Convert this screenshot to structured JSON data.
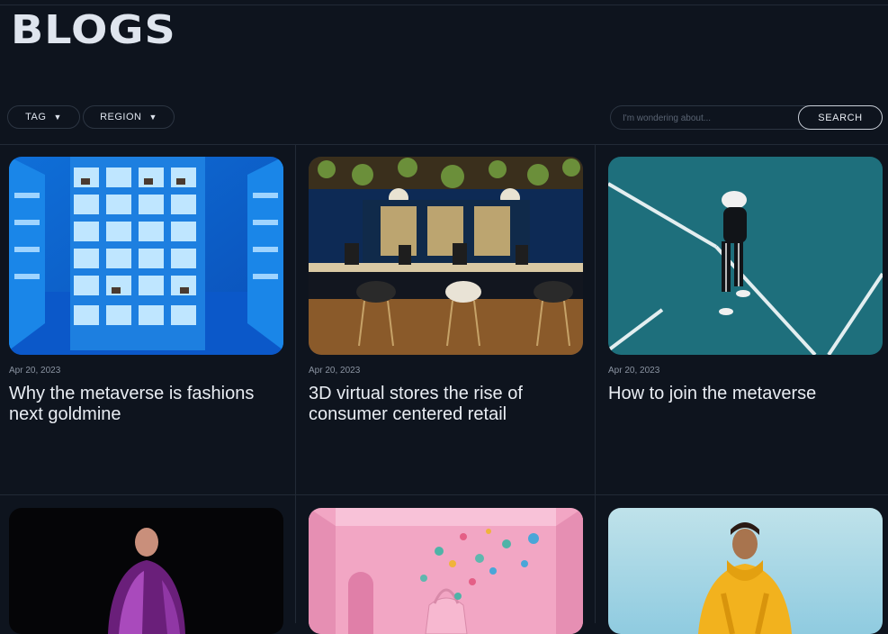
{
  "page": {
    "title": "BLOGS"
  },
  "filters": [
    {
      "label": "TAG"
    },
    {
      "label": "REGION"
    }
  ],
  "search": {
    "placeholder": "I'm wondering about...",
    "button_label": "SEARCH"
  },
  "posts": [
    {
      "date": "Apr 20, 2023",
      "title": "Why the metaverse is fashions next goldmine",
      "image": "blue-digital-store"
    },
    {
      "date": "Apr 20, 2023",
      "title": "3D virtual stores the rise of consumer centered retail",
      "image": "cafe-bar-interior"
    },
    {
      "date": "Apr 20, 2023",
      "title": "How to join the metaverse",
      "image": "vr-headset-person-court"
    },
    {
      "date": "",
      "title": "",
      "image": "person-metallic-jacket"
    },
    {
      "date": "",
      "title": "",
      "image": "pink-room-handbag"
    },
    {
      "date": "",
      "title": "",
      "image": "woman-yellow-hoodie"
    }
  ],
  "colors": {
    "background": "#0e141e",
    "divider": "#222a36",
    "text": "#e9edf3",
    "muted": "#8a93a1"
  }
}
